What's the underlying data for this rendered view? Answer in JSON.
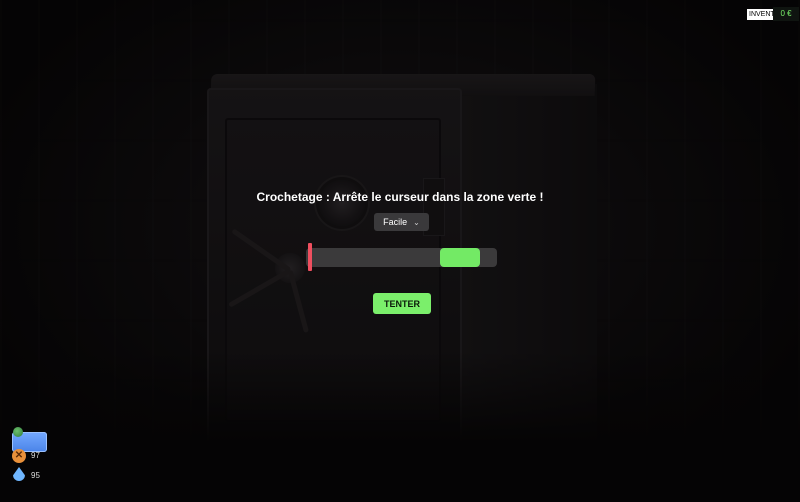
{
  "minigame": {
    "title": "Crochetage : Arrête le curseur dans la zone verte !",
    "difficulty": {
      "selected": "Facile"
    },
    "progress_bar": {
      "green_zone_start": 0.7,
      "green_zone_end": 0.91,
      "cursor_position": 0.01
    },
    "action_button": "TENTER",
    "colors": {
      "green_zone": "#73ea65",
      "cursor": "#ef4f5f",
      "button": "#7bef6b"
    }
  },
  "top_right": {
    "inventory_label": "INVENTAIRE",
    "money": "0 €"
  },
  "hud": {
    "food_value": "97",
    "water_value": "95",
    "icons": [
      "globe-icon",
      "card-icon",
      "food-icon",
      "water-drop-icon"
    ]
  }
}
